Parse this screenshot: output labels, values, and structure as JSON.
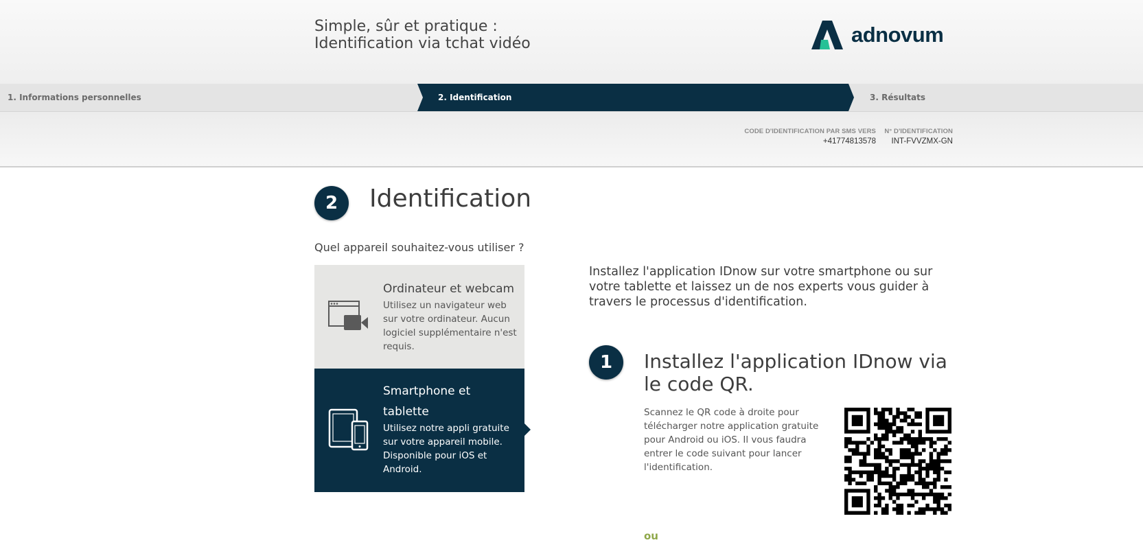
{
  "header": {
    "title_line1": "Simple, sûr et pratique :",
    "title_line2": "Identification via tchat vidéo",
    "brand": "adnovum",
    "brand_color": "#0a2f44",
    "brand_accent": "#25c196"
  },
  "steps": [
    {
      "label": "1. Informations personnelles",
      "state": "done"
    },
    {
      "label": "2. Identification",
      "state": "active"
    },
    {
      "label": "3. Résultats",
      "state": "pending"
    }
  ],
  "info": {
    "sms_label": "Code d'identification par SMS vers",
    "sms_value": "+41774813578",
    "id_label": "N° d'identification",
    "id_value": "INT-FVVZMX-GN"
  },
  "section": {
    "number": "2",
    "title": "Identification",
    "question": "Quel appareil souhaitez-vous utiliser ?"
  },
  "devices": [
    {
      "title": "Ordinateur et webcam",
      "description": "Utilisez un navigateur web sur votre ordinateur. Aucun logiciel supplémentaire n'est requis.",
      "icon": "computer-webcam-icon",
      "selected": false
    },
    {
      "title": "Smartphone et tablette",
      "description": "Utilisez notre appli gratuite sur votre appareil mobile. Disponible pour iOS et Android.",
      "icon": "tablet-smartphone-icon",
      "selected": true
    }
  ],
  "right": {
    "intro": "Installez l'application IDnow sur votre smartphone ou sur votre tablette et laissez un de nos experts vous guider à travers le processus d'identification.",
    "step_number": "1",
    "step_title": "Installez l'application IDnow via le code QR.",
    "step_desc": "Scannez le QR code à droite pour télécharger notre application gratuite pour Android ou iOS. Il vous faudra entrer le code suivant pour lancer l'identification.",
    "or": "ou",
    "qr_icon": "qr-code-icon"
  },
  "colors": {
    "primary": "#0a2f44",
    "or_green": "#8fa84a"
  }
}
